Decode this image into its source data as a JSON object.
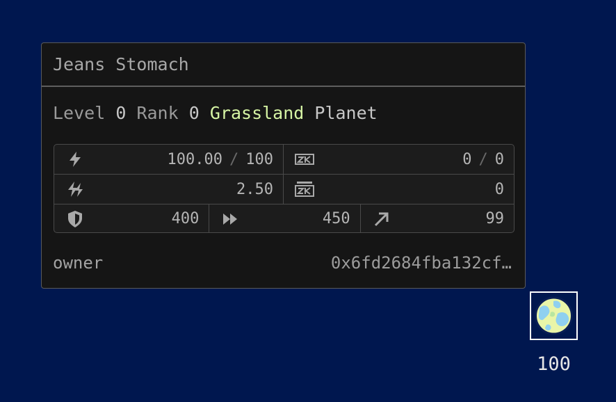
{
  "planet": {
    "name": "Jeans Stomach",
    "level_label": "Level",
    "level": "0",
    "rank_label": "Rank",
    "rank": "0",
    "biome": "Grassland",
    "kind": "Planet",
    "energy": "100.00",
    "energy_sep": "/",
    "energy_cap": "100",
    "energy_growth": "2.50",
    "zk_current": "0",
    "zk_sep": "/",
    "zk_cap": "0",
    "zk_stack": "0",
    "defense": "400",
    "speed": "450",
    "range": "99",
    "owner_label": "owner",
    "owner_address": "0x6fd2684fba132cf…",
    "map_level": "100"
  },
  "colors": {
    "background": "#00174f",
    "card": "#151515",
    "biome_accent": "#d6f4a4"
  },
  "icons": {
    "energy": "lightning-icon",
    "energy_growth": "double-lightning-icon",
    "zk": "zk-icon",
    "zk_stack": "zk-stack-icon",
    "defense": "shield-icon",
    "speed": "fast-forward-icon",
    "range": "arrow-up-right-icon"
  }
}
